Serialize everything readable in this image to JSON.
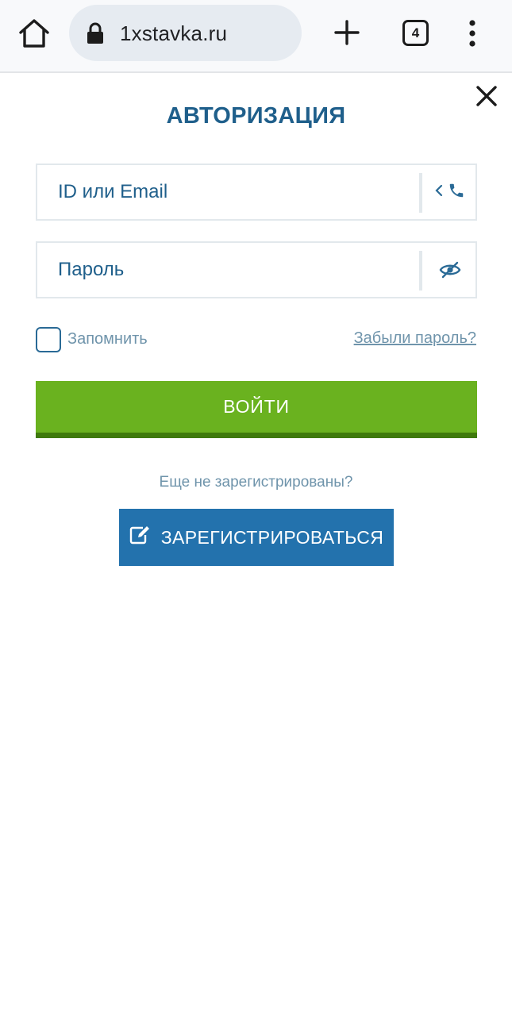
{
  "browser": {
    "url": "1xstavka.ru",
    "tab_count": "4",
    "icons": [
      "home-icon",
      "lock-icon",
      "plus-icon",
      "tabs-icon",
      "more-vert-icon"
    ]
  },
  "modal": {
    "title": "АВТОРИЗАЦИЯ",
    "id_field": {
      "placeholder": "ID или Email",
      "value": ""
    },
    "password_field": {
      "placeholder": "Пароль",
      "value": ""
    },
    "remember_label": "Запомнить",
    "remember_checked": false,
    "forgot_link": "Забыли пароль?",
    "login_button": "ВОЙТИ",
    "not_registered_text": "Еще не зарегистрированы?",
    "register_button": "ЗАРЕГИСТРИРОВАТЬСЯ"
  },
  "colors": {
    "title": "#1f5f8b",
    "login_green": "#6ab21f",
    "login_shadow": "#3f7a0c",
    "register_blue": "#2372ad",
    "muted_text": "#6f94ab"
  }
}
